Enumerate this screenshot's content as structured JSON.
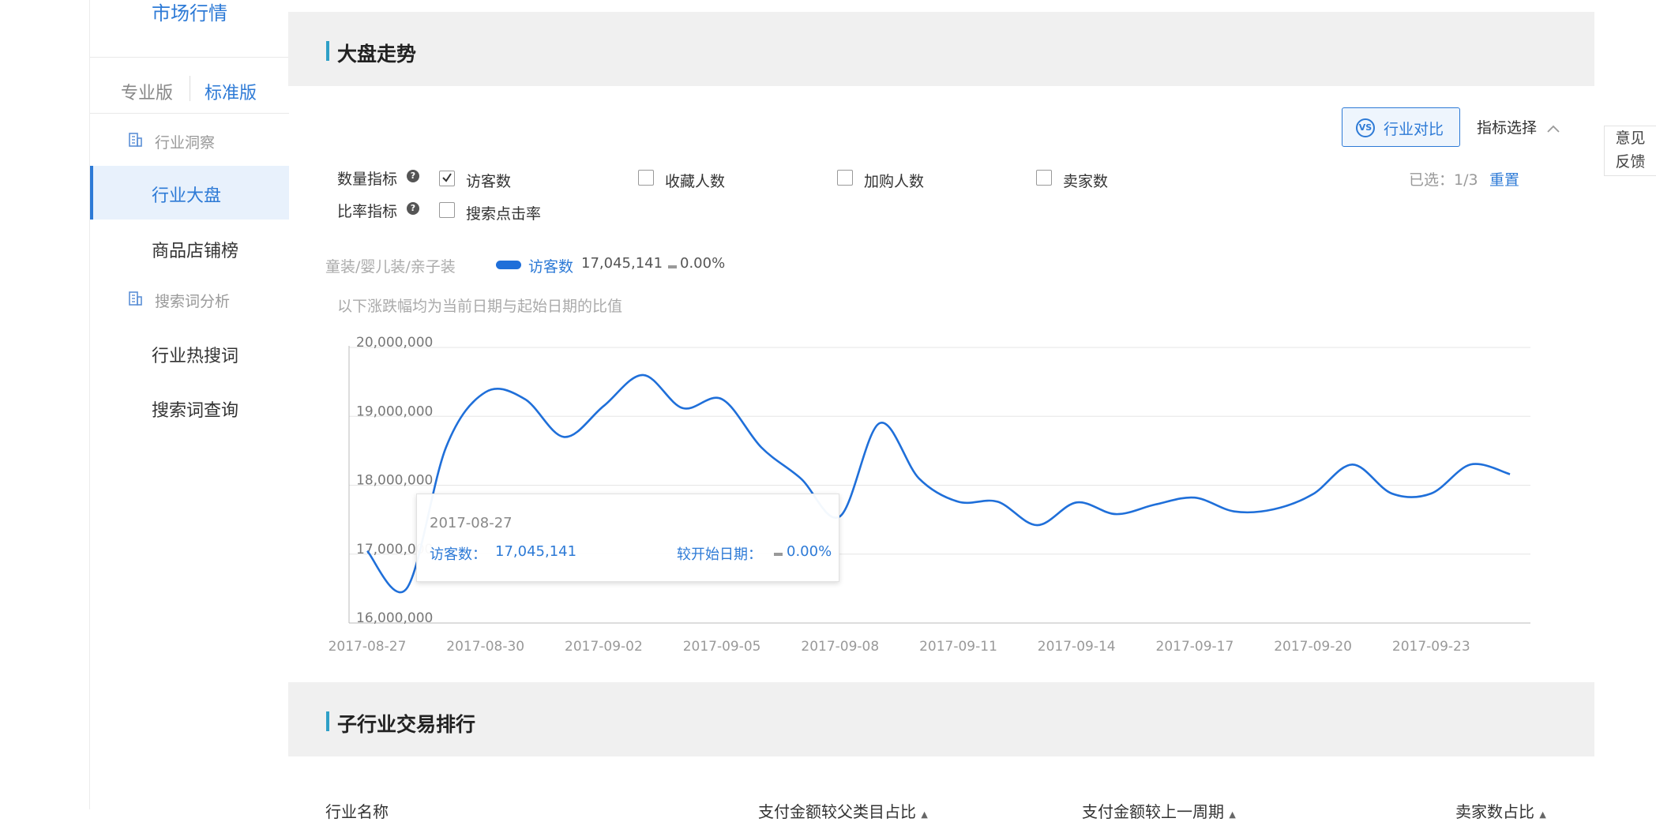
{
  "sidebar": {
    "title": "市场行情",
    "versions": {
      "pro": "专业版",
      "standard": "标准版"
    },
    "groups": [
      {
        "label": "行业洞察",
        "items": [
          "行业大盘",
          "商品店铺榜"
        ]
      },
      {
        "label": "搜索词分析",
        "items": [
          "行业热搜词",
          "搜索词查询"
        ]
      }
    ],
    "active_item": "行业大盘"
  },
  "main": {
    "section_title": "大盘走势",
    "vs_icon_text": "VS",
    "vs_button": "行业对比",
    "metric_select": "指标选择",
    "quantity_label": "数量指标",
    "ratio_label": "比率指标",
    "help_icon_text": "?",
    "checkboxes": [
      {
        "label": "访客数",
        "checked": true
      },
      {
        "label": "收藏人数",
        "checked": false
      },
      {
        "label": "加购人数",
        "checked": false
      },
      {
        "label": "卖家数",
        "checked": false
      },
      {
        "label": "搜索点击率",
        "checked": false
      }
    ],
    "selected_count": "已选：1/3",
    "reset": "重置",
    "category_path": "童装/婴儿装/亲子装",
    "legend": {
      "name": "访客数",
      "value": "17,045,141",
      "change": "0.00%"
    },
    "note": "以下涨跌幅均为当前日期与起始日期的比值",
    "tooltip": {
      "date": "2017-08-27",
      "label": "访客数：",
      "value": "17,045,141",
      "compare_label": "较开始日期：",
      "compare_value": "0.00%"
    },
    "section2_title": "子行业交易排行",
    "table_headers": [
      "行业名称",
      "支付金额较父类目占比",
      "支付金额较上一周期",
      "卖家数占比"
    ]
  },
  "feedback": [
    "意见",
    "反馈"
  ],
  "colors": {
    "accent": "#2d7ad6",
    "line": "#1f6fd9",
    "header_bar": "#2fa0c7"
  },
  "chart_data": {
    "type": "line",
    "title": "",
    "xlabel": "",
    "ylabel": "",
    "ylim": [
      16000000,
      20000000
    ],
    "y_ticks": [
      "16,000,000",
      "17,000,000",
      "18,000,000",
      "19,000,000",
      "20,000,000"
    ],
    "x_tick_labels": [
      "2017-08-27",
      "2017-08-30",
      "2017-09-02",
      "2017-09-05",
      "2017-09-08",
      "2017-09-11",
      "2017-09-14",
      "2017-09-17",
      "2017-09-20",
      "2017-09-23"
    ],
    "x": [
      "2017-08-27",
      "2017-08-28",
      "2017-08-29",
      "2017-08-30",
      "2017-08-31",
      "2017-09-01",
      "2017-09-02",
      "2017-09-03",
      "2017-09-04",
      "2017-09-05",
      "2017-09-06",
      "2017-09-07",
      "2017-09-08",
      "2017-09-09",
      "2017-09-10",
      "2017-09-11",
      "2017-09-12",
      "2017-09-13",
      "2017-09-14",
      "2017-09-15",
      "2017-09-16",
      "2017-09-17",
      "2017-09-18",
      "2017-09-19",
      "2017-09-20",
      "2017-09-21",
      "2017-09-22",
      "2017-09-23",
      "2017-09-24",
      "2017-09-25"
    ],
    "series": [
      {
        "name": "访客数",
        "values": [
          17045141,
          16500000,
          18550000,
          19350000,
          19250000,
          18700000,
          19150000,
          19600000,
          19120000,
          19250000,
          18550000,
          18100000,
          17550000,
          18900000,
          18100000,
          17760000,
          17760000,
          17420000,
          17750000,
          17580000,
          17720000,
          17820000,
          17620000,
          17650000,
          17870000,
          18300000,
          17880000,
          17880000,
          18300000,
          18160000
        ]
      }
    ],
    "grid": true,
    "legend": "top-left"
  }
}
